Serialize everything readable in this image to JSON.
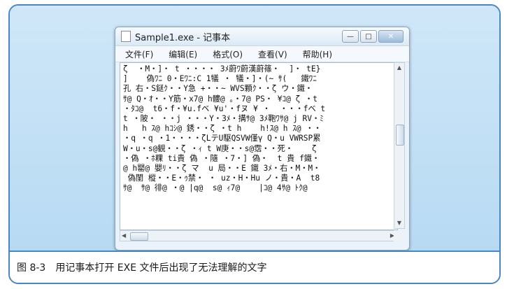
{
  "window": {
    "title": "Sample1.exe - 记事本"
  },
  "menubar": {
    "items": [
      "文件(F)",
      "编辑(E)",
      "格式(O)",
      "查看(V)",
      "帮助(H)"
    ]
  },
  "editor": {
    "content": "ζ  ・M・]・ t ・・・・ 3ﾒ蔚ﾜ蔚漢蔚篠・  ]・ tE}\n]    偽ﾜﾆ 0・Eﾜﾆ:C 1犠 ・ 犠・]・(~ ｻ(   鐵ﾜﾆ\n孔 右・S鎹ｸ・・Y急 +・・~ WVS顆ｸ・・ζ ウ・鐵・\nｻ@ Q・ｵ・・Y筋・x7@ h髏@ 。・7@ PS・ ¥ｺ@ ζ ・t\n・ﾀｺ@  t6・f・¥u.fベ ¥u'・fヌ ¥ ・  ・・・fベ t\nt ・陂・ ・・j ・・・Y・3ﾒ・搆ｻ@ 3ﾒ鞄ﾜｻ@ j RV・ﾐ\nh   h ｽ@ hｺｼ@ 銹・・ζ ・t h    h!ｽ@ h ｽ@ ・・\n・q ・q ・1・・・・ζLテU駆QSVW僅γ Q・u VWRSP累\nW・u・s@観・・ζ ・ｨ t W庚・・s@霑・・死・    ζ\n・偽 ・ﾎ粿 ti貴 偽 ・隨 ・7・] 偽・  t 貴 f鐵・\n@ h罌@ 嬰ﾘ・・ζ マ  u 局・・E 鐵 3ﾒ・右・M・M・\n 偽閨 樅・・E・ｩ禁・ ・ uz・H・Hu ノ・貴・A  t8\nｻ@  ｻ@ 徘@ ・@ |q@  s@ ｨ7@    |ｺ@ 4ｻ@ ﾄｸ@"
  },
  "caption": {
    "number": "图 8-3",
    "text": "用记事本打开 EXE 文件后出现了无法理解的文字"
  }
}
